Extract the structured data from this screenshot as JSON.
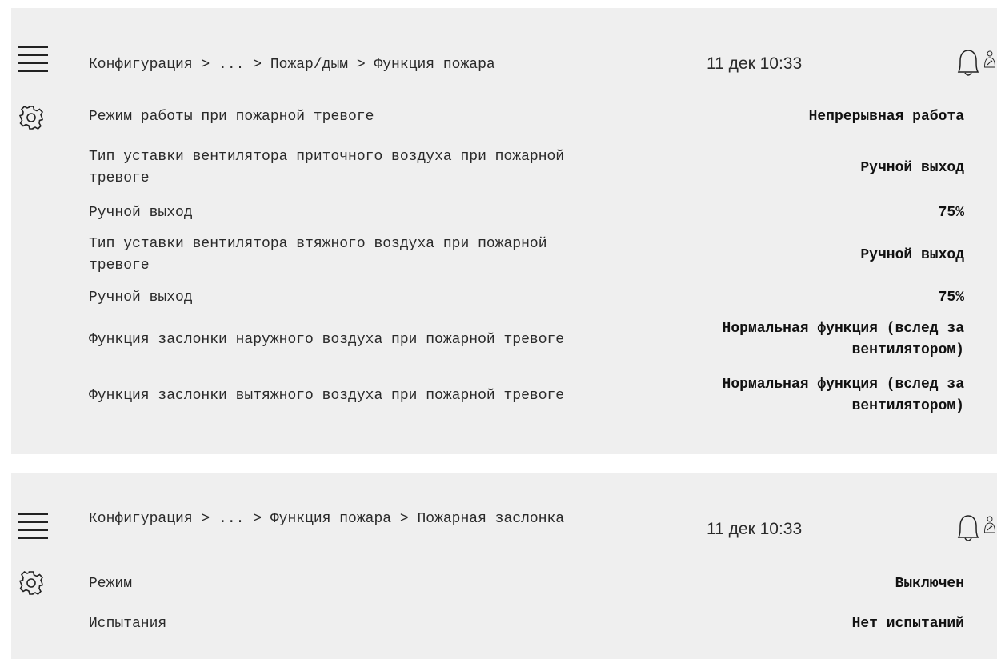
{
  "screen1": {
    "breadcrumb": "Конфигурация > ... > Пожар/дым > Функция пожара",
    "datetime": "11 дек 10:33",
    "icons": {
      "menu": "menu-icon",
      "settings": "gear-icon",
      "alarm": "bell-icon",
      "user": "user-wrench-icon"
    },
    "rows": [
      {
        "label": "Режим работы при пожарной тревоге",
        "value": "Непрерывная работа"
      },
      {
        "label": "Тип уставки вентилятора приточного воздуха при пожарной тревоге",
        "value": "Ручной выход"
      },
      {
        "label": "Ручной выход",
        "value": "75%"
      },
      {
        "label": "Тип уставки вентилятора втяжного воздуха при пожарной тревоге",
        "value": "Ручной выход"
      },
      {
        "label": "Ручной выход",
        "value": "75%"
      },
      {
        "label": "Функция заслонки наружного воздуха при пожарной тревоге",
        "value": "Нормальная функция (вслед за вентилятором)"
      },
      {
        "label": "Функция заслонки вытяжного воздуха при пожарной тревоге",
        "value": "Нормальная функция (вслед за вентилятором)"
      }
    ]
  },
  "screen2": {
    "breadcrumb": "Конфигурация > ... > Функция пожара > Пожарная заслонка",
    "datetime": "11 дек 10:33",
    "icons": {
      "menu": "menu-icon",
      "settings": "gear-icon",
      "alarm": "bell-icon",
      "user": "user-wrench-icon"
    },
    "rows": [
      {
        "label": "Режим",
        "value": "Выключен"
      },
      {
        "label": "Испытания",
        "value": "Нет испытаний"
      }
    ]
  }
}
